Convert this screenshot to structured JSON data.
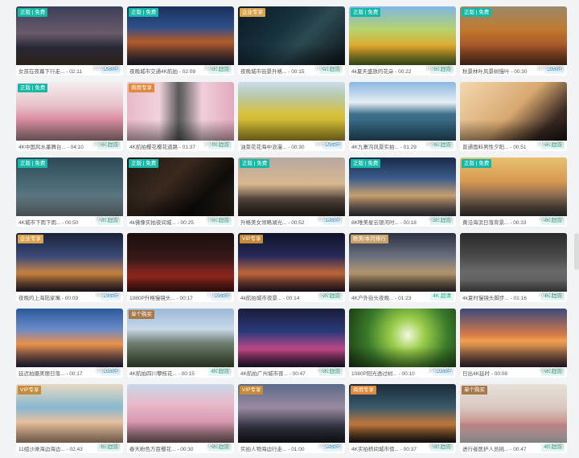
{
  "cards": [
    {
      "badge": "正版 | 免费",
      "badge_type": "free",
      "clicks": "32690点击",
      "caption": "女孩在夜幕下行走... - 02:11",
      "res": "1080P",
      "res_type": "hd",
      "bg": "linear-gradient(180deg,#3a3f58 0%,#6a5a6a 45%,#2a2a3a 70%,#4b3a2e 100%)"
    },
    {
      "badge": "正版 | 免费",
      "badge_type": "free",
      "clicks": "54911点击",
      "caption": "夜晚城市交通4K航拍 - 02:09",
      "res": "4K 超清",
      "res_type": "k4",
      "bg": "linear-gradient(180deg,#1b2f5a 0%,#2d4f8a 35%,#b35a2a 60%,#20243a 100%)"
    },
    {
      "badge": "企业专享",
      "badge_type": "ent",
      "clicks": "19543点击",
      "caption": "夜晚城市街景升格... - 00:15",
      "res": "4K 超清",
      "res_type": "k4",
      "bg": "linear-gradient(135deg,#0b1a22 0%,#16323c 40%,#2c4a52 60%,#0d1418 100%)"
    },
    {
      "badge": "正版 | 免费",
      "badge_type": "free",
      "clicks": "19283点击",
      "caption": "4k夏天盛放的花朵 - 00:22",
      "res": "4K 超清",
      "res_type": "k4",
      "bg": "linear-gradient(180deg,#7fb6e6 0%,#b7d36a 40%,#e2a62a 70%,#5a7a2a 100%)"
    },
    {
      "badge": "正版 | 免费",
      "badge_type": "free",
      "clicks": "18731点击",
      "caption": "秋景林叶风景树慢叶 - 00:30",
      "res": "1080P",
      "res_type": "hd",
      "bg": "linear-gradient(180deg,#9a8a6a 0%,#c0782e 40%,#a3542a 70%,#6a3a22 100%)"
    },
    {
      "badge": "正版 | 免费",
      "badge_type": "free",
      "clicks": "15894点击",
      "caption": "4K中国风水墨舞台... - 04:10",
      "res": "4K 超清",
      "res_type": "k4",
      "bg": "linear-gradient(180deg,#f4eef0 0%,#e8c2cc 40%,#d98aa0 65%,#b58c92 100%)"
    },
    {
      "badge": "商用专享",
      "badge_type": "com",
      "clicks": "14175点击",
      "caption": "4K航拍樱花樱花道路 - 01:37",
      "res": "4K 超清",
      "res_type": "k4",
      "bg": "linear-gradient(90deg,#e7b9c8 0%,#f1d3dc 30%,#5a5a5a 48%,#6a6a6a 52%,#f0cfd9 70%,#e2aabd 100%)"
    },
    {
      "badge": "",
      "badge_type": "",
      "clicks": "14990点击",
      "caption": "油菜花花海中浪漫... - 00:30",
      "res": "1080P",
      "res_type": "hd",
      "bg": "linear-gradient(180deg,#c9dceb 0%,#b8c8a8 25%,#d8c23a 55%,#b5a02a 100%)"
    },
    {
      "badge": "",
      "badge_type": "",
      "clicks": "14290点击",
      "caption": "4K九寨沟风景实拍... - 01:29",
      "res": "4K 超清",
      "res_type": "k4",
      "bg": "linear-gradient(180deg,#8ab8e0 0%,#e6eef4 35%,#3d6f8a 55%,#2a5a74 100%)"
    },
    {
      "badge": "",
      "badge_type": "",
      "clicks": "11996点击",
      "caption": "普通面料男性夕阳... - 00:51",
      "res": "4K 超清",
      "res_type": "k4",
      "bg": "linear-gradient(135deg,#f2d8b0 0%,#d8a870 50%,#3a2a22 80%,#1a1410 100%)"
    },
    {
      "badge": "正版 | 免费",
      "badge_type": "free",
      "clicks": "9512点击",
      "caption": "4K城市下雨下雨... - 00:50",
      "res": "4K 超清",
      "res_type": "k4",
      "bg": "linear-gradient(180deg,#2e4a58 0%,#4d6c78 50%,#7c8c92 100%)"
    },
    {
      "badge": "正版 | 免费",
      "badge_type": "free",
      "clicks": "8892点击",
      "caption": "4k佛像实拍夜间城... - 00:25",
      "res": "4K 超清",
      "res_type": "k4",
      "bg": "linear-gradient(135deg,#1a1612 0%,#3a2a1e 40%,#0e0c0a 70%,#2a2218 100%)"
    },
    {
      "badge": "正版 | 免费",
      "badge_type": "free",
      "clicks": "8524点击",
      "caption": "升格美女领略湖光... - 00:52",
      "res": "1080P",
      "res_type": "hd",
      "bg": "linear-gradient(180deg,#b8a8a0 0%,#d8b890 45%,#5a4a40 70%,#2a2420 100%)"
    },
    {
      "badge": "正版 | 免费",
      "badge_type": "free",
      "clicks": "6811点击",
      "caption": "8K唯美星云银河时... - 00:18",
      "res": "8K 超清",
      "res_type": "k8",
      "bg": "linear-gradient(180deg,#1a2a4a 0%,#3a5a8a 35%,#c8a070 65%,#3a3a4a 100%)"
    },
    {
      "badge": "正版 | 免费",
      "badge_type": "free",
      "clicks": "6453点击",
      "caption": "黄沿海滨日落背景... - 00:33",
      "res": "4K 超清",
      "res_type": "k4",
      "bg": "linear-gradient(180deg,#e8c070 0%,#d89a50 40%,#8a6a50 65%,#3a3a3a 100%)"
    },
    {
      "badge": "企业专享",
      "badge_type": "ent",
      "clicks": "5487点击",
      "caption": "夜晚的上海陆家嘴 - 00:09",
      "res": "1080P",
      "res_type": "hd",
      "bg": "linear-gradient(180deg,#1a2238 0%,#3a4a7a 40%,#d08840 70%,#2a2030 100%)"
    },
    {
      "badge": "",
      "badge_type": "",
      "clicks": "7159点击",
      "caption": "1080P升格慢镜头... - 00:17",
      "res": "1080P",
      "res_type": "hd",
      "bg": "linear-gradient(180deg,#1a0e0e 0%,#3a1a18 45%,#a02a20 75%,#4a1410 100%)"
    },
    {
      "badge": "VIP专享",
      "badge_type": "vip",
      "clicks": "1970点击",
      "caption": "4k航拍城市夜景... - 00:14",
      "res": "4K 超清",
      "res_type": "k4",
      "bg": "linear-gradient(180deg,#0e1428 0%,#2a2a5a 40%,#c86a3a 70%,#2a1a2a 100%)"
    },
    {
      "badge": "欧美/本月排行",
      "badge_type": "region",
      "clicks": "",
      "caption": "4K户外街头夜晚... - 01:23",
      "res": "4K 超清",
      "res_type": "k4",
      "bg": "linear-gradient(180deg,#2a3040 0%,#6a7080 40%,#b89a70 70%,#3a3030 100%)"
    },
    {
      "badge": "",
      "badge_type": "",
      "clicks": "6794点击",
      "caption": "4k夏时慢镜头脚步... - 01:16",
      "res": "4K 超清",
      "res_type": "k4",
      "bg": "linear-gradient(180deg,#2a2a2a 0%,#4a4a4a 40%,#7a7a7a 80%,#5a5a5a 100%)"
    },
    {
      "badge": "",
      "badge_type": "",
      "clicks": "2055点击",
      "caption": "延迟拍摄美丽日落... - 00:17",
      "res": "1080P",
      "res_type": "hd",
      "bg": "linear-gradient(180deg,#2a5a9a 0%,#6a8ac8 35%,#e8904a 60%,#2a2a4a 100%)"
    },
    {
      "badge": "单个购买",
      "badge_type": "single",
      "clicks": "33点击",
      "caption": "4K航拍四川攀枝花... - 00:15",
      "res": "4K 超清",
      "res_type": "k4",
      "bg": "linear-gradient(180deg,#9ab8d8 0%,#c8d8e8 35%,#6a7a6a 60%,#4a5a3a 100%)"
    },
    {
      "badge": "",
      "badge_type": "",
      "clicks": "6301点击",
      "caption": "4K航拍广州城市夜... - 00:47",
      "res": "4K 超清",
      "res_type": "k4",
      "bg": "linear-gradient(180deg,#1a1e3a 0%,#2a3a7a 40%,#c84a8a 70%,#2a1a3a 100%)"
    },
    {
      "badge": "",
      "badge_type": "",
      "clicks": "2065点击",
      "caption": "1080P阳光透过树... - 00:10",
      "res": "1080P",
      "res_type": "hd",
      "bg": "radial-gradient(circle at 55% 45%,#f4f8e0 0%,#9acd4a 25%,#3a7a2a 60%,#1a3a14 100%)"
    },
    {
      "badge": "",
      "badge_type": "",
      "clicks": "5953点击",
      "caption": "日出4K延时 - 00:08",
      "res": "4K 超清",
      "res_type": "k4",
      "bg": "linear-gradient(180deg,#3a4a7a 0%,#d87a4a 45%,#f0a050 55%,#3a2a3a 100%)"
    },
    {
      "badge": "VIP专享",
      "badge_type": "vip",
      "clicks": "199点击",
      "caption": "11组沙滩海边海边... - 02:43",
      "res": "4K 超清",
      "res_type": "k4",
      "bg": "linear-gradient(180deg,#e8d8c0 0%,#88b8d0 40%,#e8c0a0 65%,#c8a080 100%)"
    },
    {
      "badge": "",
      "badge_type": "",
      "clicks": "3639点击",
      "caption": "春天粉色万亩樱花... - 00:30",
      "res": "4K 超清",
      "res_type": "k4",
      "bg": "linear-gradient(180deg,#c8d8e8 0%,#e8b8c8 35%,#d898b0 65%,#8a6a70 100%)"
    },
    {
      "badge": "VIP专享",
      "badge_type": "vip",
      "clicks": "1094点击",
      "caption": "实拍人物海边行走... - 01:00",
      "res": "1080P",
      "res_type": "hd",
      "bg": "linear-gradient(180deg,#5a6a8a 0%,#9a8aa0 40%,#3a3a4a 70%,#1a1a22 100%)"
    },
    {
      "badge": "商用专享",
      "badge_type": "com",
      "clicks": "5813点击",
      "caption": "4K实拍桥间城市傍... - 00:37",
      "res": "4K 超清",
      "res_type": "k4",
      "bg": "linear-gradient(180deg,#1a2a3a 0%,#3a5a6a 40%,#c87a3a 70%,#1a1a1a 100%)"
    },
    {
      "badge": "单个购买",
      "badge_type": "single",
      "clicks": "13点击",
      "caption": "进行者医护人员挑... - 00:47",
      "res": "4K 超清",
      "res_type": "k4",
      "bg": "linear-gradient(180deg,#e8e0d8 0%,#d8c8c0 40%,#c88a8a 70%,#e8e8e8 100%)"
    }
  ]
}
